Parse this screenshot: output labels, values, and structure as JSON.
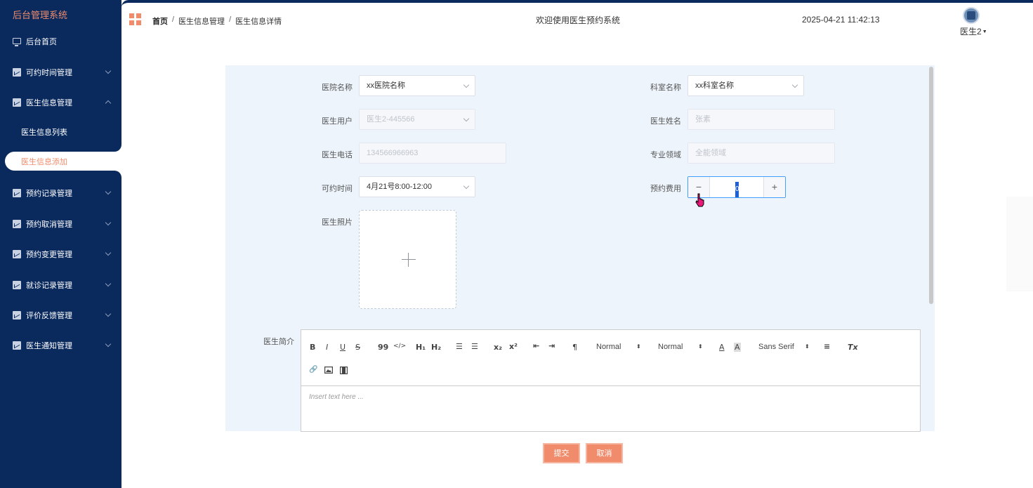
{
  "sidebar": {
    "title": "后台管理系统",
    "items": [
      {
        "label": "后台首页",
        "icon": "monitor-icon"
      },
      {
        "label": "可约时间管理",
        "icon": "chart-icon"
      },
      {
        "label": "医生信息管理",
        "icon": "chart-icon"
      },
      {
        "label": "预约记录管理",
        "icon": "chart-icon"
      },
      {
        "label": "预约取消管理",
        "icon": "chart-icon"
      },
      {
        "label": "预约变更管理",
        "icon": "chart-icon"
      },
      {
        "label": "就诊记录管理",
        "icon": "chart-icon"
      },
      {
        "label": "评价反馈管理",
        "icon": "chart-icon"
      },
      {
        "label": "医生通知管理",
        "icon": "chart-icon"
      }
    ],
    "sub_items": [
      {
        "label": "医生信息列表"
      },
      {
        "label": "医生信息添加"
      }
    ]
  },
  "header": {
    "breadcrumb": [
      "首页",
      "医生信息管理",
      "医生信息详情"
    ],
    "breadcrumb_sep": "/",
    "welcome": "欢迎使用医生预约系统",
    "datetime": "2025-04-21 11:42:13",
    "user": "医生2",
    "user_caret": "▼"
  },
  "form": {
    "hospital_label": "医院名称",
    "hospital_value": "xx医院名称",
    "dept_label": "科室名称",
    "dept_value": "xx科室名称",
    "doctor_user_label": "医生用户",
    "doctor_user_value": "医生2-445566",
    "doctor_name_label": "医生姓名",
    "doctor_name_value": "张素",
    "phone_label": "医生电话",
    "phone_value": "134566966963",
    "specialty_label": "专业领域",
    "specialty_value": "全能领域",
    "time_label": "可约时间",
    "time_value": "4月21号8:00-12:00",
    "fee_label": "预约费用",
    "fee_value": "0",
    "fee_minus": "−",
    "fee_plus": "+",
    "photo_label": "医生照片",
    "intro_label": "医生简介"
  },
  "editor": {
    "bold": "B",
    "italic": "I",
    "underline": "U",
    "strike": "S",
    "blockquote": "99",
    "code": "</>",
    "h1": "H₁",
    "h2": "H₂",
    "ordered_list": "☰",
    "bullet_list": "☰",
    "sub": "x₂",
    "sup": "x²",
    "outdent": "⇤",
    "indent": "⇥",
    "direction": "¶",
    "size_1": "Normal",
    "size_2": "Normal",
    "color": "A",
    "bg_color": "A",
    "font": "Sans Serif",
    "align": "≡",
    "clean": "Tx",
    "link": "🔗",
    "select_arrow": "⬍",
    "placeholder": "Insert text here ..."
  },
  "buttons": {
    "submit": "提交",
    "cancel": "取消"
  },
  "colors": {
    "sidebar_bg": "#0a2a5e",
    "accent": "#f08c6c",
    "panel_bg": "#edf4fb"
  }
}
